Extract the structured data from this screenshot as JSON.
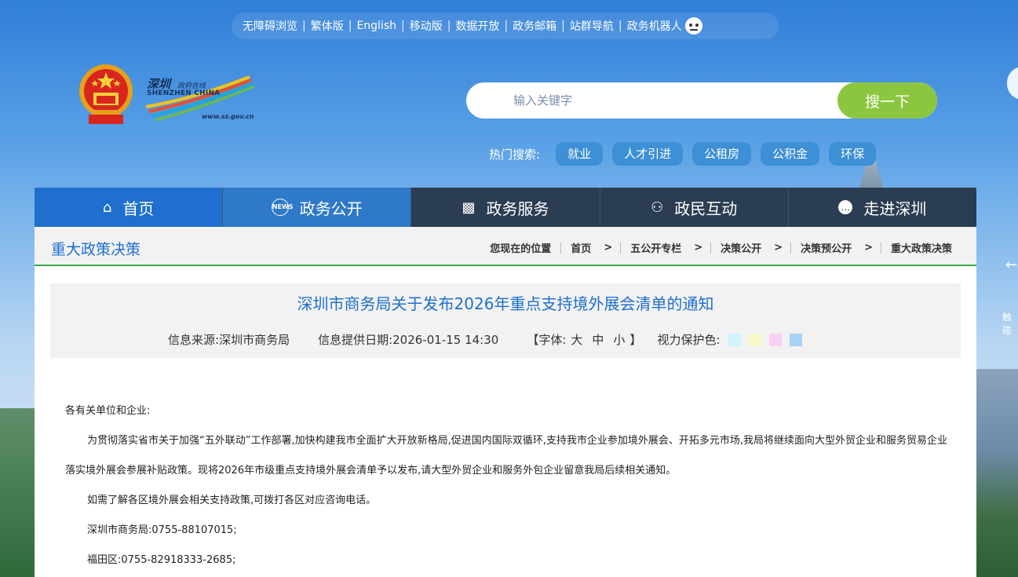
{
  "top_links": {
    "items": [
      "无障碍浏览",
      "繁体版",
      "English",
      "移动版",
      "数据开放",
      "政务邮箱",
      "站群导航",
      "政务机器人"
    ]
  },
  "logo": {
    "cn": "深圳",
    "cn_small": "政府在线",
    "en": "SHENZHEN CHINA",
    "url": "www.sz.gov.cn"
  },
  "search": {
    "placeholder": "输入关键字",
    "button": "搜一下"
  },
  "hot_search": {
    "label": "热门搜索:",
    "tags": [
      "就业",
      "人才引进",
      "公租房",
      "公积金",
      "环保"
    ]
  },
  "nav": {
    "items": [
      "首页",
      "政务公开",
      "政务服务",
      "政民互动",
      "走进深圳"
    ],
    "news_icon_text": "NEWS"
  },
  "breadcrumb": {
    "section_title": "重大政策决策",
    "location_label": "您现在的位置",
    "items": [
      "首页",
      "五公开专栏",
      "决策公开",
      "决策预公开",
      "重大政策决策"
    ]
  },
  "article": {
    "title": "深圳市商务局关于发布2026年重点支持境外展会清单的通知",
    "source_label": "信息来源:",
    "source": "深圳市商务局",
    "date_label": "信息提供日期:",
    "date": "2026-01-15 14:30",
    "font_label_open": "【字体:",
    "font_sizes": [
      "大",
      "中",
      "小"
    ],
    "font_label_close": "】",
    "eye_color_label": "视力保护色:",
    "eye_colors": [
      "#cff4fa",
      "#f7f7c9",
      "#f8d0f5",
      "#a9d2f7"
    ],
    "paragraphs": [
      "各有关单位和企业:",
      "为贯彻落实省市关于加强“五外联动”工作部署,加快构建我市全面扩大开放新格局,促进国内国际双循环,支持我市企业参加境外展会、开拓多元市场,我局将继续面向大型外贸企业和服务贸易企业落实境外展会参展补贴政策。现将2026年市级重点支持境外展会清单予以发布,请大型外贸企业和服务外包企业留意我局后续相关通知。",
      "如需了解各区境外展会相关支持政策,可拨打各区对应咨询电话。",
      "深圳市商务局:0755-88107015;",
      "福田区:0755-82918333-2685;"
    ]
  },
  "side": {
    "text": "触碰"
  }
}
